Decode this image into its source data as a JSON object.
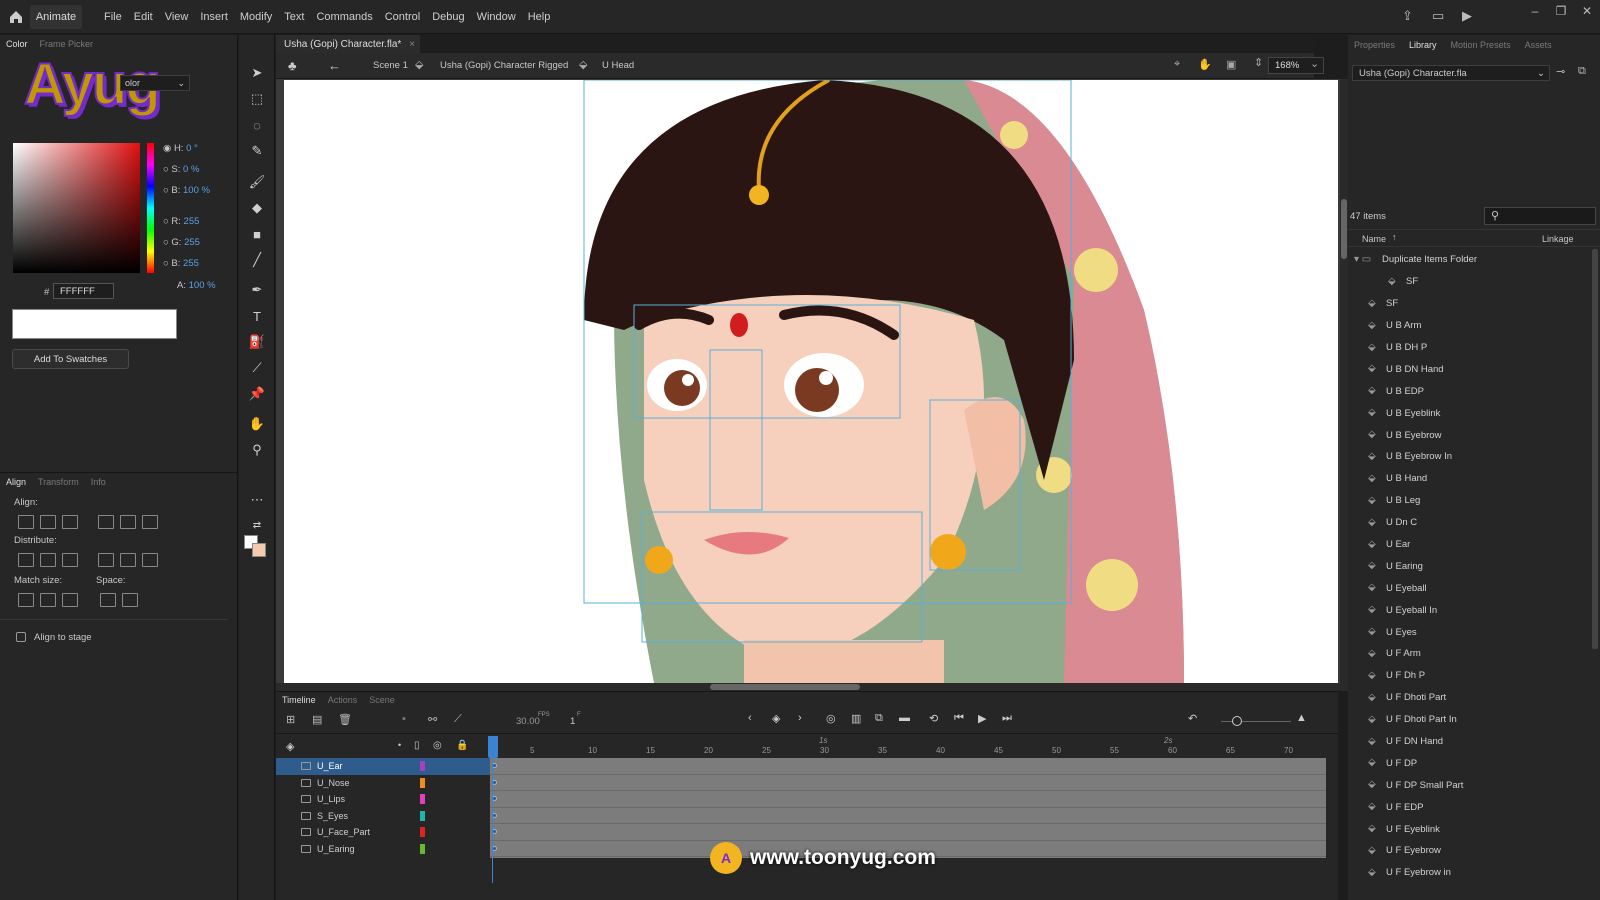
{
  "app": {
    "name": "Animate"
  },
  "menus": [
    "File",
    "Edit",
    "View",
    "Insert",
    "Modify",
    "Text",
    "Commands",
    "Control",
    "Debug",
    "Window",
    "Help"
  ],
  "left_panel": {
    "tabs": [
      "Color",
      "Frame Picker"
    ],
    "color_type": "olor",
    "hsb": {
      "h_label": "H:",
      "h": "0 °",
      "s_label": "S:",
      "s": "0 %",
      "b_label": "B:",
      "b": "100 %"
    },
    "rgb": {
      "r_label": "R:",
      "r": "255",
      "g_label": "G:",
      "g": "255",
      "b_label": "B:",
      "b": "255",
      "a_label": "A:",
      "a": "100 %"
    },
    "hex_label": "#",
    "hex": "FFFFFF",
    "add_swatches": "Add To Swatches",
    "align_tabs": [
      "Align",
      "Transform",
      "Info"
    ],
    "align_label": "Align:",
    "distribute_label": "Distribute:",
    "match_size_label": "Match size:",
    "space_label": "Space:",
    "align_to_stage": "Align to stage"
  },
  "document": {
    "tab": "Usha (Gopi) Character.fla*",
    "breadcrumbs": [
      "Scene 1",
      "Usha (Gopi) Character Rigged",
      "U Head"
    ],
    "zoom": "168%"
  },
  "timeline": {
    "tabs": [
      "Timeline",
      "Actions",
      "Scene"
    ],
    "fps": "30.00",
    "fps_unit": "FPS",
    "frame": "1",
    "frame_unit": "F",
    "ruler_ticks": [
      "5",
      "10",
      "15",
      "20",
      "25",
      "30",
      "35",
      "40",
      "45",
      "50",
      "55",
      "60",
      "65",
      "70"
    ],
    "ruler_sec": [
      "1s",
      "2s"
    ],
    "layers": [
      {
        "name": "U_Ear",
        "color": "#a83fbf",
        "selected": true
      },
      {
        "name": "U_Nose",
        "color": "#f08c1c",
        "selected": false
      },
      {
        "name": "U_Lips",
        "color": "#e23fbf",
        "selected": false
      },
      {
        "name": "S_Eyes",
        "color": "#1fb5a8",
        "selected": false
      },
      {
        "name": "U_Face_Part",
        "color": "#e02424",
        "selected": false
      },
      {
        "name": "U_Earing",
        "color": "#6cb82c",
        "selected": false
      }
    ]
  },
  "right_panel": {
    "tabs": [
      "Properties",
      "Library",
      "Motion Presets",
      "Assets"
    ],
    "library_file": "Usha (Gopi) Character.fla",
    "count": "47 items",
    "col_name": "Name",
    "col_linkage": "Linkage",
    "items": [
      "Duplicate Items Folder",
      "SF",
      "SF",
      "U B Arm",
      "U B DH P",
      "U B DN Hand",
      "U B EDP",
      "U B Eyeblink",
      "U B Eyebrow",
      "U B Eyebrow In",
      "U B Hand",
      "U B Leg",
      "U Dn C",
      "U Ear",
      "U Earing",
      "U Eyeball",
      "U Eyeball In",
      "U Eyes",
      "U F Arm",
      "U F Dh P",
      "U F Dhoti Part",
      "U F Dhoti Part In",
      "U F DN Hand",
      "U F DP",
      "U F DP Small Part",
      "U F EDP",
      "U F Eyeblink",
      "U F Eyebrow",
      "U F Eyebrow in"
    ]
  },
  "watermark": {
    "url": "www.toonyug.com",
    "logo": "Ayug"
  }
}
